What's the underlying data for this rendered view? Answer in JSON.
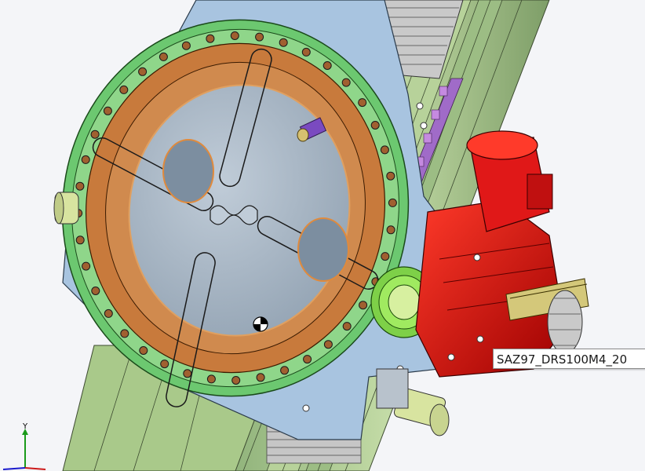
{
  "viewport": {
    "tooltip_text": "SAZ97_DRS100M4_20",
    "triad_y_label": "Y"
  },
  "colors": {
    "background": "#f4f5f8",
    "rail_green": "#a9c98a",
    "rail_purple": "#a06bc8",
    "magenta_rod": "#c0208a",
    "ring_orange": "#c87a3c",
    "ring_green": "#6cc870",
    "plate_blue": "#a8c4e0",
    "disc_gray": "#a8b6c4",
    "motor_red": "#d01010",
    "gear_green": "#8ee050",
    "bracket_olive": "#d4c87a"
  }
}
